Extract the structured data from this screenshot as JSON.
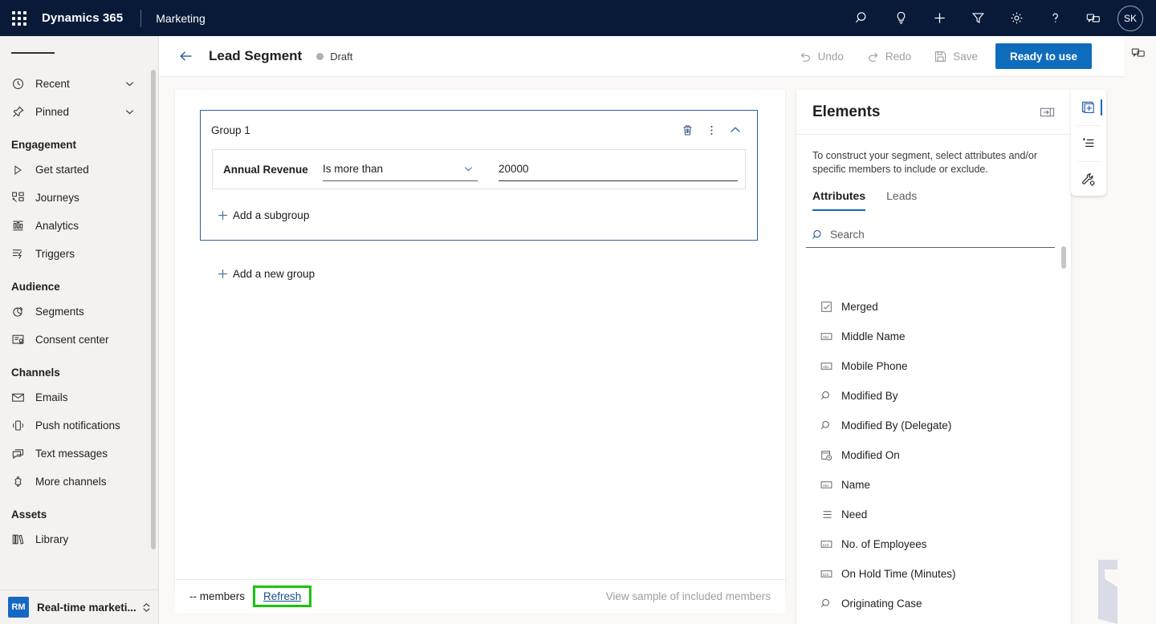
{
  "topbar": {
    "brand": "Dynamics 365",
    "app_name": "Marketing",
    "icons": [
      "waffle-icon",
      "search-icon",
      "insights-lightbulb-icon",
      "add-icon",
      "filter-icon",
      "settings-gear-icon",
      "help-question-icon",
      "feedback-chat-icon"
    ],
    "avatar_initials": "SK",
    "background_color": "#091A38"
  },
  "sidebar": {
    "quick": [
      {
        "label": "Recent",
        "icon": "clock-icon",
        "expandable": true
      },
      {
        "label": "Pinned",
        "icon": "pin-icon",
        "expandable": true
      }
    ],
    "groups": [
      {
        "title": "Engagement",
        "items": [
          {
            "label": "Get started",
            "icon": "play-triangle-icon"
          },
          {
            "label": "Journeys",
            "icon": "journeys-icon"
          },
          {
            "label": "Analytics",
            "icon": "analytics-bar-icon"
          },
          {
            "label": "Triggers",
            "icon": "triggers-bolt-icon"
          }
        ]
      },
      {
        "title": "Audience",
        "items": [
          {
            "label": "Segments",
            "icon": "segments-pie-icon"
          },
          {
            "label": "Consent center",
            "icon": "consent-certificate-icon"
          }
        ]
      },
      {
        "title": "Channels",
        "items": [
          {
            "label": "Emails",
            "icon": "envelope-icon"
          },
          {
            "label": "Push notifications",
            "icon": "mobile-push-icon"
          },
          {
            "label": "Text messages",
            "icon": "sms-chat-icon"
          },
          {
            "label": "More channels",
            "icon": "more-channels-icon"
          }
        ]
      },
      {
        "title": "Assets",
        "items": [
          {
            "label": "Library",
            "icon": "library-books-icon"
          }
        ]
      }
    ],
    "app_switcher": {
      "badge": "RM",
      "label": "Real-time marketi..."
    }
  },
  "command_bar": {
    "back": "back-arrow-icon",
    "title": "Lead Segment",
    "status": "Draft",
    "undo_label": "Undo",
    "redo_label": "Redo",
    "save_label": "Save",
    "primary_label": "Ready to use",
    "primary_color": "#0f6cbd"
  },
  "segment_builder": {
    "group": {
      "title": "Group 1",
      "actions": [
        "delete-trash-icon",
        "more-options-icon",
        "collapse-chevron-up-icon"
      ],
      "condition": {
        "attribute": "Annual Revenue",
        "operator": "Is more than",
        "value": "20000"
      },
      "add_subgroup_label": "Add a subgroup"
    },
    "add_new_group_label": "Add a new group"
  },
  "footer": {
    "members_text": "-- members",
    "refresh_label": "Refresh",
    "refresh_highlight_color": "#16c60c",
    "view_sample_label": "View sample of included members"
  },
  "elements_panel": {
    "title": "Elements",
    "collapse_icon": "collapse-panel-icon",
    "description": "To construct your segment, select attributes and/or specific members to include or exclude.",
    "tabs": [
      {
        "label": "Attributes",
        "active": true
      },
      {
        "label": "Leads",
        "active": false
      }
    ],
    "search_placeholder": "Search",
    "attributes": [
      {
        "label": "Merged",
        "icon": "checkbox-type-icon"
      },
      {
        "label": "Middle Name",
        "icon": "text-abc-type-icon"
      },
      {
        "label": "Mobile Phone",
        "icon": "text-abc-type-icon"
      },
      {
        "label": "Modified By",
        "icon": "lookup-search-type-icon"
      },
      {
        "label": "Modified By (Delegate)",
        "icon": "lookup-search-type-icon"
      },
      {
        "label": "Modified On",
        "icon": "datetime-type-icon"
      },
      {
        "label": "Name",
        "icon": "text-abc-type-icon"
      },
      {
        "label": "Need",
        "icon": "optionset-list-type-icon"
      },
      {
        "label": "No. of Employees",
        "icon": "number-123-type-icon"
      },
      {
        "label": "On Hold Time (Minutes)",
        "icon": "number-123-type-icon"
      },
      {
        "label": "Originating Case",
        "icon": "lookup-search-type-icon"
      }
    ]
  },
  "right_rail": {
    "items": [
      {
        "icon": "add-element-icon",
        "active": true
      },
      {
        "icon": "starred-list-icon",
        "active": false
      },
      {
        "icon": "tools-wrench-icon",
        "active": false
      }
    ]
  }
}
